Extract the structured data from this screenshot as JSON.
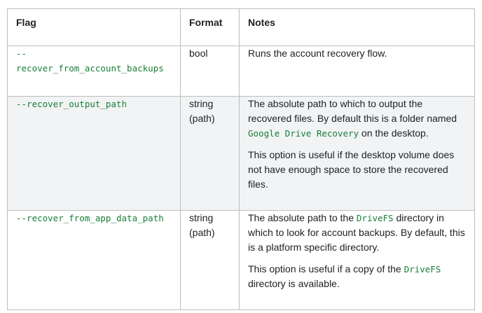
{
  "headers": {
    "flag": "Flag",
    "format": "Format",
    "notes": "Notes"
  },
  "rows": [
    {
      "flag_line1": "--",
      "flag_line2": "recover_from_account_backups",
      "format": "bool",
      "notes": [
        {
          "parts": [
            {
              "text": "Runs the account recovery flow.",
              "code": false
            }
          ]
        }
      ]
    },
    {
      "flag": "--recover_output_path",
      "format_line1": "string",
      "format_line2": "(path)",
      "notes_p1_a": "The absolute path to which to output the recovered files. By default this is a folder named ",
      "notes_p1_code": "Google Drive Recovery",
      "notes_p1_b": " on the desktop.",
      "notes_p2": "This option is useful if the desktop volume does not have enough space to store the recovered files."
    },
    {
      "flag": "--recover_from_app_data_path",
      "format_line1": "string",
      "format_line2": "(path)",
      "notes_p1_a": "The absolute path to the ",
      "notes_p1_code": "DriveFS",
      "notes_p1_b": " directory in which to look for account backups. By default, this is a platform specific directory.",
      "notes_p2_a": "This option is useful if a copy of the ",
      "notes_p2_code": "DriveFS",
      "notes_p2_b": " directory is available."
    }
  ],
  "colors": {
    "code_text": "#188038",
    "shaded_row": "#f1f3f4",
    "border": "#bdbdbd"
  }
}
